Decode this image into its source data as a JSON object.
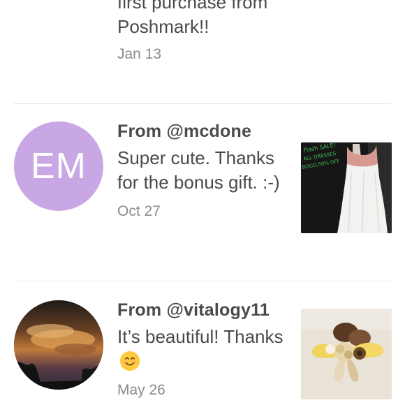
{
  "feed": {
    "top_entry": {
      "message": "first purchase from Poshmark!!",
      "date": "Jan 13"
    },
    "entries": [
      {
        "from": "From @mcdone",
        "avatar_initials": "EM",
        "avatar_color": "#c8a7e4",
        "message": "Super cute. Thanks for the bonus gift. :-)",
        "date": "Oct 27",
        "thumbnail_caption": [
          "Flash SALE!",
          "ALL DRESSES",
          "BOGO,50% OFF"
        ]
      },
      {
        "from": "From @vitalogy11",
        "message": "It’s beautiful! Thanks",
        "emoji": "smiling-face-icon",
        "date": "May 26"
      }
    ]
  }
}
